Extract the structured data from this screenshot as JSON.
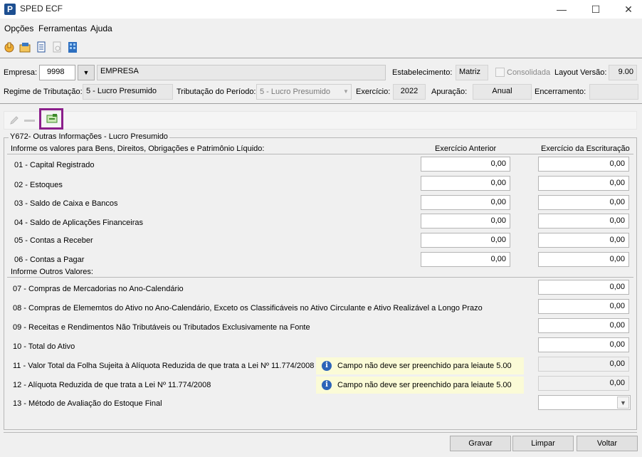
{
  "window": {
    "title": "SPED ECF",
    "minimize": "—",
    "maximize": "☐",
    "close": "✕"
  },
  "menu": [
    "Opções",
    "Ferramentas",
    "Ajuda"
  ],
  "header": {
    "empresa_label": "Empresa:",
    "empresa_code": "9998",
    "empresa_name": "EMPRESA",
    "estabelecimento_label": "Estabelecimento:",
    "estabelecimento_value": "Matriz",
    "consolidada_label": "Consolidada",
    "layout_label": "Layout Versão:",
    "layout_value": "9.00",
    "regime_label": "Regime de Tributação:",
    "regime_value": "5 - Lucro Presumido",
    "tributacao_label": "Tributação do Período:",
    "tributacao_value": "5 - Lucro Presumido",
    "exercicio_label": "Exercício:",
    "exercicio_value": "2022",
    "apuracao_label": "Apuração:",
    "apuracao_value": "Anual",
    "encerramento_label": "Encerramento:",
    "encerramento_value": ""
  },
  "group": {
    "title": "Y672- Outras Informações - Lucro Presumido",
    "section1_label": "Informe os valores para Bens, Direitos, Obrigações e Patrimônio Líquido:",
    "col_anterior": "Exercício Anterior",
    "col_escrituracao": "Exercício da Escrituração",
    "rows1": [
      {
        "label": "01 - Capital Registrado",
        "anterior": "0,00",
        "escrituracao": "0,00"
      },
      {
        "label": "02 - Estoques",
        "anterior": "0,00",
        "escrituracao": "0,00"
      },
      {
        "label": "03 - Saldo de Caixa e Bancos",
        "anterior": "0,00",
        "escrituracao": "0,00"
      },
      {
        "label": "04 - Saldo de Aplicações Financeiras",
        "anterior": "0,00",
        "escrituracao": "0,00"
      },
      {
        "label": "05 - Contas a Receber",
        "anterior": "0,00",
        "escrituracao": "0,00"
      },
      {
        "label": "06 - Contas a Pagar",
        "anterior": "0,00",
        "escrituracao": "0,00"
      }
    ],
    "section2_label": "Informe Outros Valores:",
    "rows2": [
      {
        "label": "07 - Compras de Mercadorias no Ano-Calendário",
        "value": "0,00"
      },
      {
        "label": "08 - Compras de Elememtos do Ativo no Ano-Calendário, Exceto os Classificáveis no Ativo Circulante e Ativo  Realizável a Longo Prazo",
        "value": "0,00"
      },
      {
        "label": "09 - Receitas e Rendimentos Não Tributáveis ou Tributados Exclusivamente na Fonte",
        "value": "0,00"
      },
      {
        "label": "10 - Total do Ativo",
        "value": "0,00"
      },
      {
        "label": "11 - Valor Total da Folha Sujeita à Alíquota Reduzida de que trata a Lei Nº 11.774/2008",
        "value": "0,00",
        "info": "Campo não deve ser preenchido para leiaute 5.00"
      },
      {
        "label": "12 - Alíquota Reduzida de que trata a Lei Nº 11.774/2008",
        "value": "0,00",
        "info": "Campo não deve ser preenchido para leiaute 5.00"
      },
      {
        "label": "13 - Método de Avaliação do Estoque Final",
        "value": ""
      }
    ]
  },
  "buttons": {
    "gravar": "Gravar",
    "limpar": "Limpar",
    "voltar": "Voltar"
  },
  "colors": {
    "highlight": "#8b1f8b",
    "info_bg": "#fbfbd7",
    "info_icon": "#2d64b8"
  }
}
